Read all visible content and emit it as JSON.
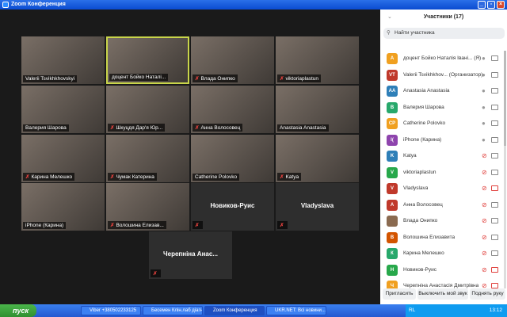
{
  "window": {
    "title": "Zoom Конференция"
  },
  "tiles": [
    {
      "name": "Valerii Tsvikhkhovskyi",
      "muted": false
    },
    {
      "name": "доцент Бойко Наталі...",
      "muted": false,
      "speaking": true
    },
    {
      "name": "Влада Онипко",
      "muted": true
    },
    {
      "name": "viktoriaplastun",
      "muted": true
    },
    {
      "name": "Валерия Шарова",
      "muted": false
    },
    {
      "name": "Шкуцдя Дар'я Юр...",
      "muted": true
    },
    {
      "name": "Анна Волосовец",
      "muted": true
    },
    {
      "name": "Anastasia Anastasia",
      "muted": false
    },
    {
      "name": "Карина Мелешко",
      "muted": true
    },
    {
      "name": "Чумак Катерина",
      "muted": true
    },
    {
      "name": "Catherine Polovko",
      "muted": false
    },
    {
      "name": "Katya",
      "muted": true
    },
    {
      "name": "iPhone (Карина)",
      "muted": false
    },
    {
      "name": "Волошина Елизав...",
      "muted": true
    },
    {
      "name": "Новиков-Руис",
      "muted": true,
      "no_video": true
    },
    {
      "name": "Vladyslava",
      "muted": true,
      "no_video": true
    },
    {
      "name": "Черепніна Анас...",
      "muted": true,
      "no_video": true
    }
  ],
  "panel": {
    "title": "Участники (17)",
    "search_placeholder": "Найти участника",
    "participants": [
      {
        "initials": "A",
        "name": "доцент Бойко Наталія Івані... (Я)",
        "color": "#f0a020",
        "muted": false,
        "cam_off": false
      },
      {
        "initials": "VT",
        "name": "Valerii Tsvikhkhov... (Организатор)",
        "color": "#c0392b",
        "muted": false,
        "cam_off": false
      },
      {
        "initials": "AA",
        "name": "Anastasia Anastasia",
        "color": "#2e7fb8",
        "muted": false,
        "cam_off": false
      },
      {
        "initials": "В",
        "name": "Валерия Шарова",
        "color": "#27a86b",
        "muted": false,
        "cam_off": false
      },
      {
        "initials": "CP",
        "name": "Catherine Polovko",
        "color": "#f0a020",
        "muted": false,
        "cam_off": false
      },
      {
        "initials": "I(",
        "name": "iPhone (Карина)",
        "color": "#8e44ad",
        "muted": false,
        "cam_off": false
      },
      {
        "initials": "K",
        "name": "Katya",
        "color": "#2e7fb8",
        "muted": true,
        "cam_off": false
      },
      {
        "initials": "V",
        "name": "viktoriaplastun",
        "color": "#27a84b",
        "muted": true,
        "cam_off": false
      },
      {
        "initials": "V",
        "name": "Vladyslava",
        "color": "#c0392b",
        "muted": true,
        "cam_off": true
      },
      {
        "initials": "А",
        "name": "Анна Волосовец",
        "color": "#c0392b",
        "muted": true,
        "cam_off": false
      },
      {
        "initials": "",
        "name": "Влада Онипко",
        "color": "#8a6a50",
        "muted": true,
        "cam_off": false
      },
      {
        "initials": "В",
        "name": "Волошина Елизавита",
        "color": "#d35400",
        "muted": true,
        "cam_off": false
      },
      {
        "initials": "К",
        "name": "Карина Мелешко",
        "color": "#27a86b",
        "muted": true,
        "cam_off": false
      },
      {
        "initials": "Н",
        "name": "Новиков-Руис",
        "color": "#27a84b",
        "muted": true,
        "cam_off": true
      },
      {
        "initials": "Ч",
        "name": "Черепніна Анастасія Дмитрівна",
        "color": "#f0a020",
        "muted": true,
        "cam_off": true
      }
    ],
    "buttons": {
      "invite": "Пригласить",
      "mute_me": "Выключить мой звук",
      "raise_hand": "Поднять руку"
    }
  },
  "taskbar": {
    "start": "пуск",
    "items": [
      "Viber +380502233125",
      "Бесемен Клін.лаб діагн",
      "Zoom Конференция",
      "UKR.NET: Всі новини..."
    ],
    "lang": "RL",
    "clock": "13:12"
  }
}
